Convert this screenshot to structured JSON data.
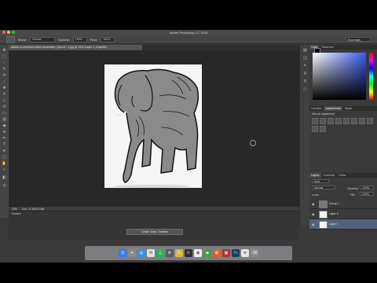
{
  "window": {
    "title": "Adobe Photoshop CC 2015"
  },
  "options_bar": {
    "mode_label": "Mode:",
    "mode_value": "Normal",
    "opacity_label": "Opacity:",
    "opacity_value": "100%",
    "flow_label": "Flow:",
    "flow_value": "100%",
    "workspace": "Essentials"
  },
  "document": {
    "tab_title": "sketch-of-elephant-vector-illustration_fJpovH...1.jpg @ 33% (Layer 1, Gray/8#)"
  },
  "status_bar": {
    "zoom": "33%",
    "doc_size": "Doc: 11.8M/23.6M"
  },
  "timeline": {
    "title": "Timeline",
    "create_button": "Create Video Timeline"
  },
  "color_panel": {
    "tabs": [
      "Color",
      "Swatches"
    ]
  },
  "adjustments_panel": {
    "tabs": [
      "Libraries",
      "Adjustments",
      "Styles"
    ],
    "hint": "Add an adjustment"
  },
  "layers_panel": {
    "tabs": [
      "Layers",
      "Channels",
      "Paths"
    ],
    "filter_kind": "Kind",
    "blend_mode": "Normal",
    "opacity_label": "Opacity:",
    "opacity_value": "100%",
    "lock_label": "Lock:",
    "fill_label": "Fill:",
    "fill_value": "100%",
    "layers": [
      {
        "name": "Group 1"
      },
      {
        "name": "Layer 0"
      },
      {
        "name": "Layer 1"
      }
    ]
  },
  "colors": {
    "window_bg": "#3a3a3a",
    "canvas_bg": "#282828",
    "selection": "#56627a"
  }
}
